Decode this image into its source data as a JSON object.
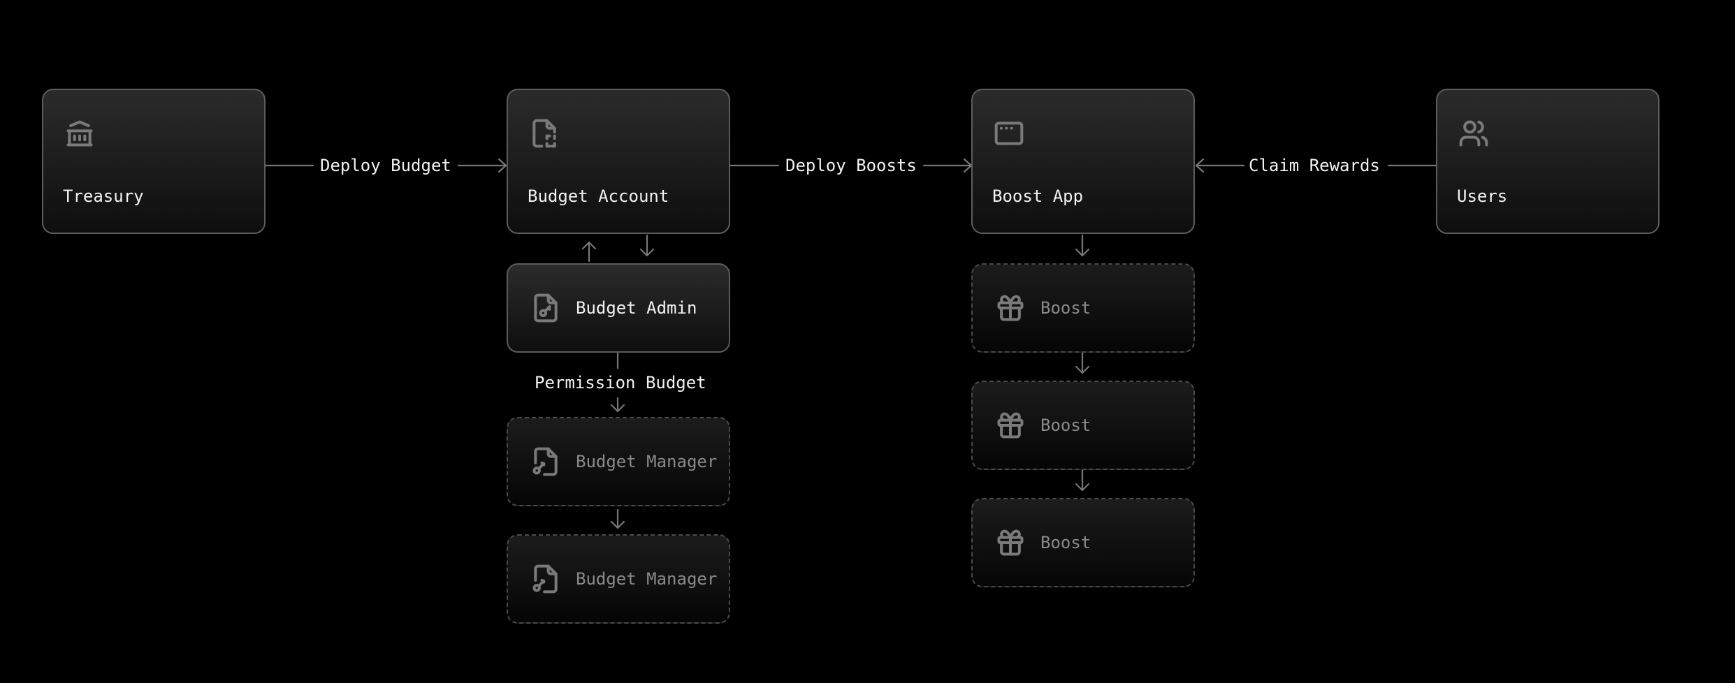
{
  "nodes": {
    "treasury": {
      "label": "Treasury",
      "icon": "bank-icon"
    },
    "budget_account": {
      "label": "Budget Account",
      "icon": "file-dashed-corner-icon"
    },
    "boost_app": {
      "label": "Boost App",
      "icon": "app-window-icon"
    },
    "users": {
      "label": "Users",
      "icon": "users-icon"
    },
    "budget_admin": {
      "label": "Budget Admin",
      "icon": "file-key-icon"
    },
    "budget_manager_1": {
      "label": "Budget Manager",
      "icon": "file-key-icon"
    },
    "budget_manager_2": {
      "label": "Budget Manager",
      "icon": "file-key-icon"
    },
    "boost_1": {
      "label": "Boost",
      "icon": "gift-icon"
    },
    "boost_2": {
      "label": "Boost",
      "icon": "gift-icon"
    },
    "boost_3": {
      "label": "Boost",
      "icon": "gift-icon"
    }
  },
  "edges": {
    "deploy_budget": "Deploy Budget",
    "deploy_boosts": "Deploy Boosts",
    "claim_rewards": "Claim Rewards",
    "permission_budget": "Permission Budget"
  },
  "colors": {
    "background": "#000000",
    "node_border": "#5c5c5c",
    "dashed_border": "#4a4a4a",
    "wire": "#777777",
    "active_text": "#f2f2f2",
    "muted_text": "#8a8a8a"
  }
}
